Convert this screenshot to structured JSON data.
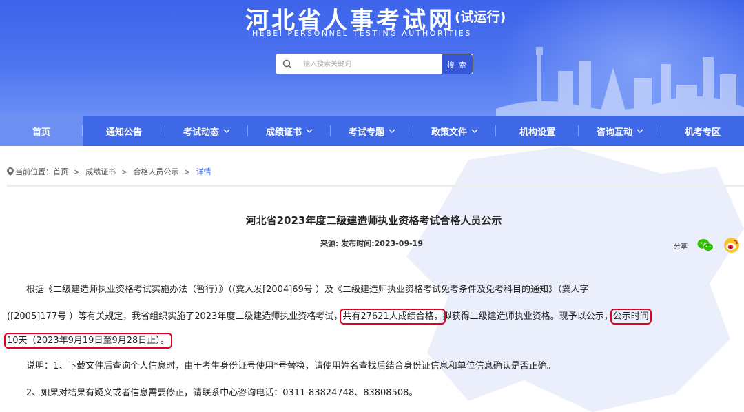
{
  "header": {
    "title": "河北省人事考试网",
    "tag": "(试运行)",
    "subtitle_en": "HEBEI PERSONNEL TESTING AUTHORITIES",
    "search": {
      "placeholder": "输入搜索关键词",
      "button_label": "搜 索"
    }
  },
  "nav": {
    "items": [
      {
        "label": "首页",
        "active": true,
        "dropdown": false
      },
      {
        "label": "通知公告",
        "active": false,
        "dropdown": false
      },
      {
        "label": "考试动态",
        "active": false,
        "dropdown": true
      },
      {
        "label": "成绩证书",
        "active": false,
        "dropdown": true
      },
      {
        "label": "考试专题",
        "active": false,
        "dropdown": true
      },
      {
        "label": "政策文件",
        "active": false,
        "dropdown": true
      },
      {
        "label": "机构设置",
        "active": false,
        "dropdown": false
      },
      {
        "label": "咨询互动",
        "active": false,
        "dropdown": true
      },
      {
        "label": "机考专区",
        "active": false,
        "dropdown": false
      }
    ]
  },
  "breadcrumb": {
    "prefix": "当前位置：",
    "items": [
      "首页",
      "成绩证书",
      "合格人员公示",
      "详情"
    ],
    "separator": ">"
  },
  "article": {
    "title": "河北省2023年度二级建造师执业资格考试合格人员公示",
    "meta": "来源:  发布时间:2023-09-19",
    "share_label": "分享",
    "share_icons": [
      "wechat-icon",
      "weibo-icon"
    ],
    "p1_line1": "根据《二级建造师执业资格考试实施办法（暂行）》（(冀人发[2004]69号 ）及《二级建造师执业资格考试免考条件及免考科目的通知》（冀人字",
    "p1_line2_a": "([2005]177号 ）等有关规定，我省组织实施了2023年度二级建造师执业资格考试，",
    "p1_line2_hl1": "共有27621人成绩合格，",
    "p1_line2_b": "拟获得二级建造师执业资格。现予以公示，",
    "p1_line2_hl2": "公示时间",
    "p1_line3_hl": "10天（2023年9月19日至9月28日止）。",
    "note1": "说明：1、下载文件后查询个人信息时，由于考生身份证号使用*号替换，请使用姓名查找后结合身份证信息和单位信息确认是否正确。",
    "note2": "2、如果对结果有疑义或者信息需要修正，请联系中心咨询电话：0311-83824748、83808508。"
  },
  "colors": {
    "banner": "#4466ec",
    "nav": "#3f68e6",
    "nav_active": "#6d8ff2",
    "highlight": "#e1001f",
    "breadcrumb_current": "#4a70e8"
  }
}
